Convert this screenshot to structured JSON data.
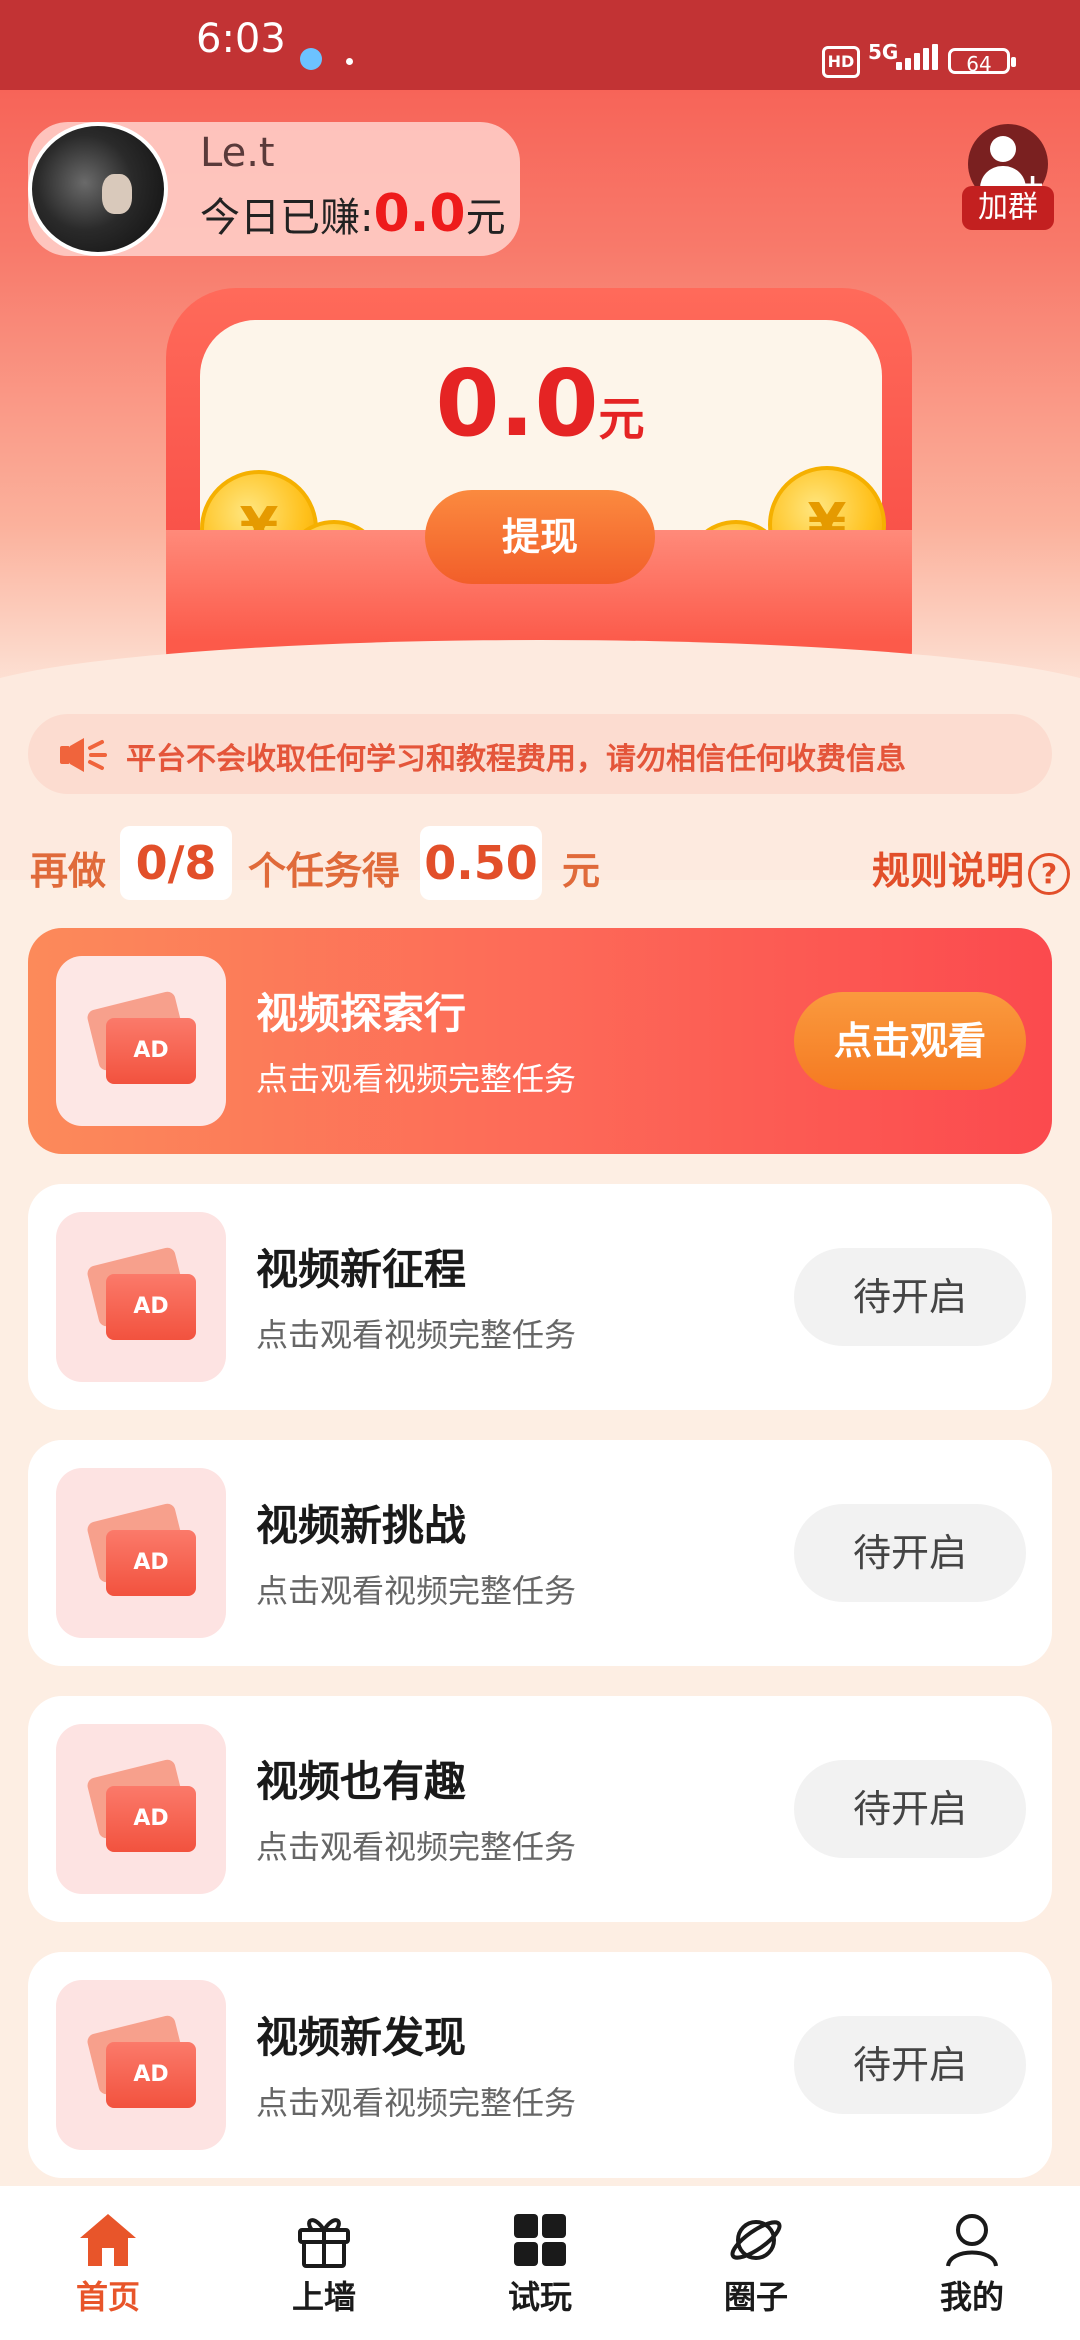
{
  "status_bar": {
    "time": "6:03",
    "hd": "HD",
    "network": "5G",
    "battery": "64"
  },
  "user": {
    "name": "Le.t",
    "earned_label": "今日已赚:",
    "earned_value": "0.0",
    "earned_unit": "元"
  },
  "join_group": {
    "label": "加群",
    "icon": "add-user-icon"
  },
  "balance": {
    "value": "0.0",
    "unit": "元",
    "coin_symbol": "¥",
    "withdraw_label": "提现"
  },
  "notice": {
    "icon": "speaker-icon",
    "text": "平台不会收取任何学习和教程费用，请勿相信任何收费信息"
  },
  "progress": {
    "prefix": "再做",
    "count": "0/8",
    "middle": "个任务得",
    "reward": "0.50",
    "suffix": "元",
    "rules_label": "规则说明",
    "rules_icon_glyph": "?"
  },
  "tasks": [
    {
      "thumb_text": "AD",
      "title": "视频探索行",
      "subtitle": "点击观看视频完整任务",
      "button": "点击观看"
    },
    {
      "thumb_text": "AD",
      "title": "视频新征程",
      "subtitle": "点击观看视频完整任务",
      "button": "待开启"
    },
    {
      "thumb_text": "AD",
      "title": "视频新挑战",
      "subtitle": "点击观看视频完整任务",
      "button": "待开启"
    },
    {
      "thumb_text": "AD",
      "title": "视频也有趣",
      "subtitle": "点击观看视频完整任务",
      "button": "待开启"
    },
    {
      "thumb_text": "AD",
      "title": "视频新发现",
      "subtitle": "点击观看视频完整任务",
      "button": "待开启"
    }
  ],
  "tabs": [
    {
      "label": "首页",
      "icon": "home-icon",
      "active": true
    },
    {
      "label": "上墙",
      "icon": "gift-icon"
    },
    {
      "label": "试玩",
      "icon": "grid-icon"
    },
    {
      "label": "圈子",
      "icon": "planet-icon"
    },
    {
      "label": "我的",
      "icon": "user-icon"
    }
  ],
  "colors": {
    "accent": "#e8552a",
    "status_bar": "#c23334",
    "money_red": "#ee1b1b"
  }
}
